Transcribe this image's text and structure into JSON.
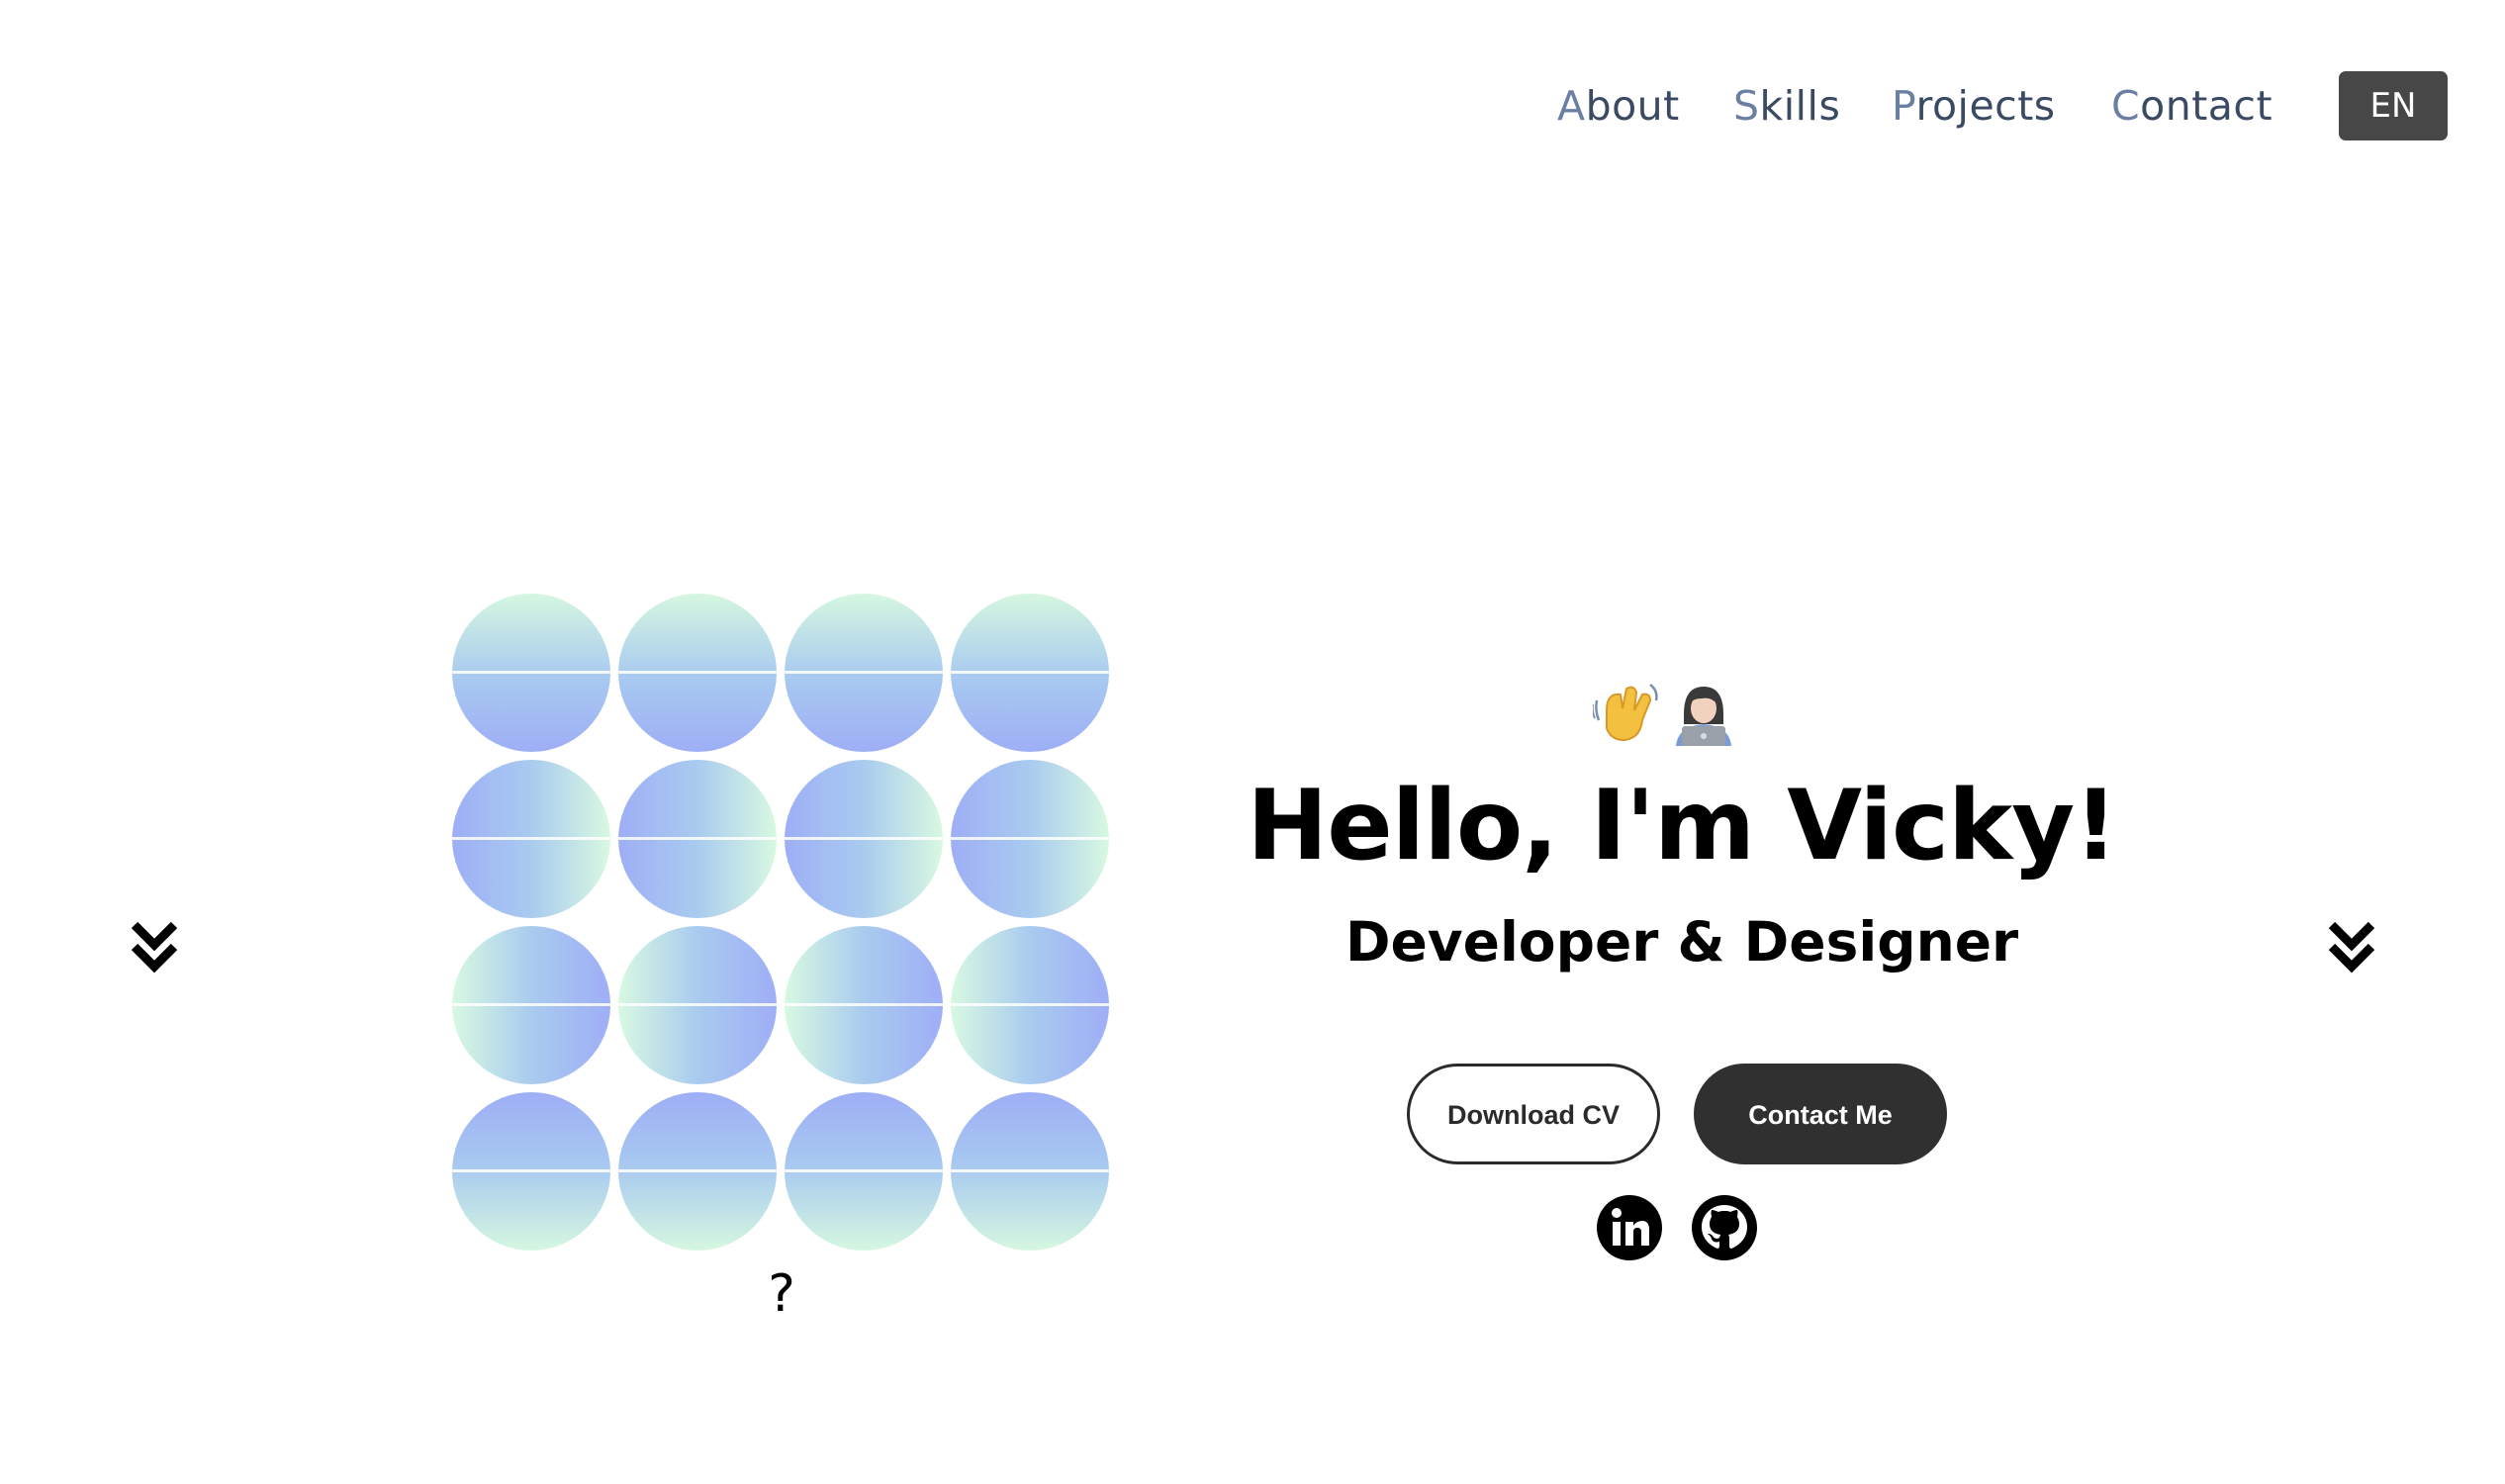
{
  "nav": {
    "items": [
      {
        "first": "A",
        "rest": "bout"
      },
      {
        "first": "S",
        "rest": "kills"
      },
      {
        "first": "P",
        "rest": "rojects"
      },
      {
        "first": "C",
        "rest": "ontact"
      }
    ],
    "language": "EN"
  },
  "hero": {
    "emojis": [
      "waving-hand",
      "technologist"
    ],
    "greeting": "Hello, I'm Vicky!",
    "role": "Developer & Designer",
    "download_label": "Download CV",
    "contact_label": "Contact Me",
    "social": [
      "linkedin-icon",
      "github-icon"
    ]
  },
  "art": {
    "question_mark": "?",
    "rows": 4,
    "columns": 4,
    "colors": {
      "green": "#d5f7e0",
      "blue": "#9eaef6",
      "mid": "#a7c8f0"
    }
  },
  "colors": {
    "nav_text": "#3b4a63",
    "nav_accent": "#6b7fa3",
    "lang_bg": "#474747",
    "button_dark": "#303030"
  }
}
